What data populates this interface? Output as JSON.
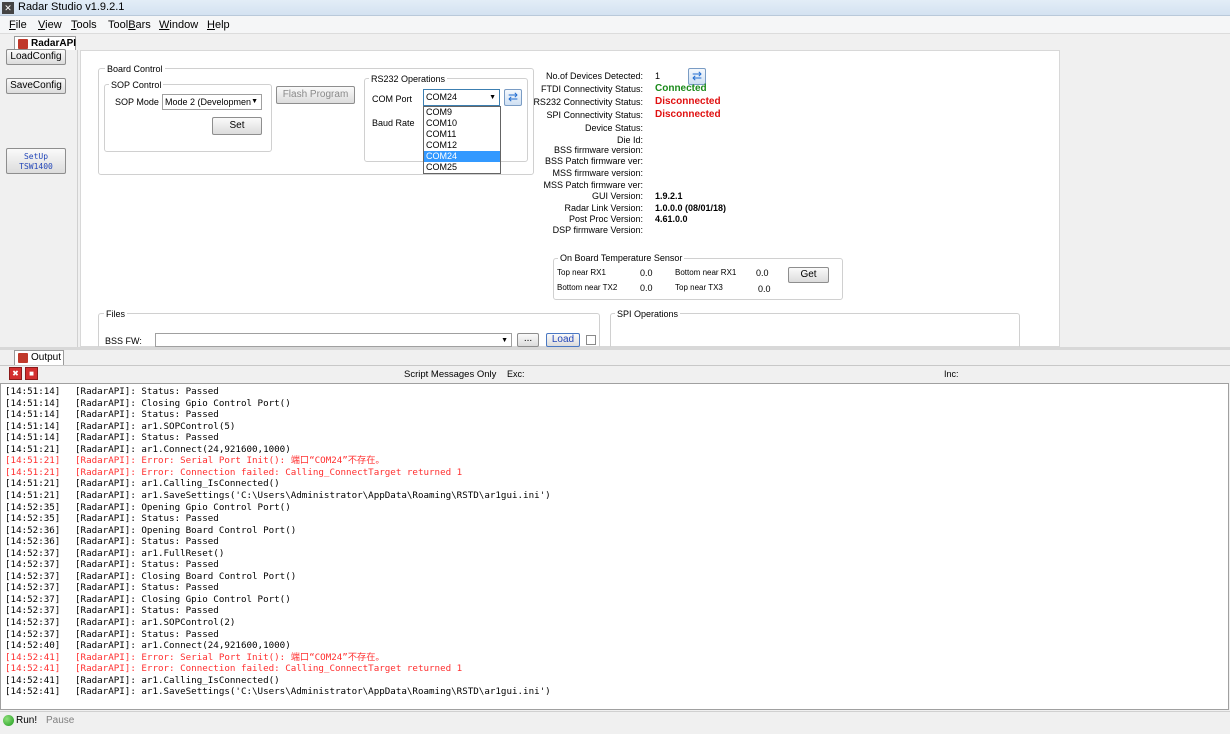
{
  "window": {
    "title": "Radar Studio v1.9.2.1"
  },
  "menu": {
    "file": "File",
    "file_key": "F",
    "view": "View",
    "view_key": "V",
    "tools": "Tools",
    "tools_key": "T",
    "toolbars": "ToolBars",
    "toolbars_key": "B",
    "window": "Window",
    "window_key": "W",
    "help": "Help",
    "help_key": "H"
  },
  "tabs": {
    "radarapi": "RadarAPI",
    "output": "Output"
  },
  "left": {
    "load_config": "LoadConfig",
    "save_config": "SaveConfig",
    "setup_line1": "SetUp",
    "setup_line2": "TSW1400"
  },
  "board_control": {
    "title": "Board Control",
    "sop_title": "SOP Control",
    "sop_mode_label": "SOP Mode",
    "sop_mode_value": "Mode 2 (Developmen",
    "set_button": "Set",
    "flash_button": "Flash Program",
    "rs232_title": "RS232 Operations",
    "com_port_label": "COM Port",
    "com_port_value": "COM24",
    "baud_rate_label": "Baud Rate",
    "com_options": [
      "COM9",
      "COM10",
      "COM11",
      "COM12",
      "COM24",
      "COM25"
    ],
    "com_selected": "COM24"
  },
  "status": {
    "devices_label": "No.of Devices Detected:",
    "devices_value": "1",
    "ftdi_label": "FTDI Connectivity Status:",
    "ftdi_value": "Connected",
    "rs232_label": "RS232 Connectivity Status:",
    "rs232_value": "Disconnected",
    "spi_label": "SPI Connectivity Status:",
    "spi_value": "Disconnected",
    "device_status_label": "Device Status:",
    "die_id_label": "Die Id:",
    "bss_fw_label": "BSS firmware version:",
    "bss_patch_label": "BSS Patch firmware ver:",
    "mss_fw_label": "MSS firmware version:",
    "mss_patch_label": "MSS Patch firmware ver:",
    "gui_label": "GUI Version:",
    "gui_value": "1.9.2.1",
    "radar_link_label": "Radar Link Version:",
    "radar_link_value": "1.0.0.0 (08/01/18)",
    "post_proc_label": "Post Proc Version:",
    "post_proc_value": "4.61.0.0",
    "dsp_label": "DSP firmware Version:"
  },
  "temperature": {
    "title": "On Board Temperature Sensor",
    "top_rx1_label": "Top near RX1",
    "top_rx1_value": "0.0",
    "bottom_rx1_label": "Bottom near RX1",
    "bottom_rx1_value": "0.0",
    "bottom_tx2_label": "Bottom near TX2",
    "bottom_tx2_value": "0.0",
    "top_tx3_label": "Top near TX3",
    "top_tx3_value": "0.0",
    "get_button": "Get"
  },
  "files": {
    "title": "Files",
    "bss_fw_label": "BSS FW:",
    "browse_button": "...",
    "load_button": "Load"
  },
  "spi": {
    "title": "SPI Operations"
  },
  "output_toolbar": {
    "script_only": "Script Messages Only",
    "exc_label": "Exc:",
    "inc_label": "Inc:"
  },
  "log": [
    {
      "t": "[14:51:14]",
      "m": "[RadarAPI]: Status: Passed",
      "err": false
    },
    {
      "t": "[14:51:14]",
      "m": "[RadarAPI]: Closing Gpio Control Port()",
      "err": false
    },
    {
      "t": "[14:51:14]",
      "m": "[RadarAPI]: Status: Passed",
      "err": false
    },
    {
      "t": "[14:51:14]",
      "m": "[RadarAPI]: ar1.SOPControl(5)",
      "err": false
    },
    {
      "t": "[14:51:14]",
      "m": "[RadarAPI]: Status: Passed",
      "err": false
    },
    {
      "t": "[14:51:21]",
      "m": "[RadarAPI]: ar1.Connect(24,921600,1000)",
      "err": false
    },
    {
      "t": "[14:51:21]",
      "m": "[RadarAPI]: Error: Serial Port Init(): 端口“COM24”不存在。",
      "err": true
    },
    {
      "t": "[14:51:21]",
      "m": "[RadarAPI]: Error: Connection failed: Calling_ConnectTarget returned 1",
      "err": true
    },
    {
      "t": "[14:51:21]",
      "m": "[RadarAPI]: ar1.Calling_IsConnected()",
      "err": false
    },
    {
      "t": "[14:51:21]",
      "m": "[RadarAPI]: ar1.SaveSettings('C:\\Users\\Administrator\\AppData\\Roaming\\RSTD\\ar1gui.ini')",
      "err": false
    },
    {
      "t": "[14:52:35]",
      "m": "[RadarAPI]: Opening Gpio Control Port()",
      "err": false
    },
    {
      "t": "[14:52:35]",
      "m": "[RadarAPI]: Status: Passed",
      "err": false
    },
    {
      "t": "[14:52:36]",
      "m": "[RadarAPI]: Opening Board Control Port()",
      "err": false
    },
    {
      "t": "[14:52:36]",
      "m": "[RadarAPI]: Status: Passed",
      "err": false
    },
    {
      "t": "[14:52:37]",
      "m": "[RadarAPI]: ar1.FullReset()",
      "err": false
    },
    {
      "t": "[14:52:37]",
      "m": "[RadarAPI]: Status: Passed",
      "err": false
    },
    {
      "t": "[14:52:37]",
      "m": "[RadarAPI]: Closing Board Control Port()",
      "err": false
    },
    {
      "t": "[14:52:37]",
      "m": "[RadarAPI]: Status: Passed",
      "err": false
    },
    {
      "t": "[14:52:37]",
      "m": "[RadarAPI]: Closing Gpio Control Port()",
      "err": false
    },
    {
      "t": "[14:52:37]",
      "m": "[RadarAPI]: Status: Passed",
      "err": false
    },
    {
      "t": "[14:52:37]",
      "m": "[RadarAPI]: ar1.SOPControl(2)",
      "err": false
    },
    {
      "t": "[14:52:37]",
      "m": "[RadarAPI]: Status: Passed",
      "err": false
    },
    {
      "t": "[14:52:40]",
      "m": "[RadarAPI]: ar1.Connect(24,921600,1000)",
      "err": false
    },
    {
      "t": "[14:52:41]",
      "m": "[RadarAPI]: Error: Serial Port Init(): 端口“COM24”不存在。",
      "err": true
    },
    {
      "t": "[14:52:41]",
      "m": "[RadarAPI]: Error: Connection failed: Calling_ConnectTarget returned 1",
      "err": true
    },
    {
      "t": "[14:52:41]",
      "m": "[RadarAPI]: ar1.Calling_IsConnected()",
      "err": false
    },
    {
      "t": "[14:52:41]",
      "m": "[RadarAPI]: ar1.SaveSettings('C:\\Users\\Administrator\\AppData\\Roaming\\RSTD\\ar1gui.ini')",
      "err": false
    }
  ],
  "statusbar": {
    "run": "Run!",
    "pause": "Pause"
  },
  "colors": {
    "connected": "#1a8a1a",
    "disconnected": "#e01010",
    "error_log": "#ff3030",
    "selection": "#3399ff"
  }
}
